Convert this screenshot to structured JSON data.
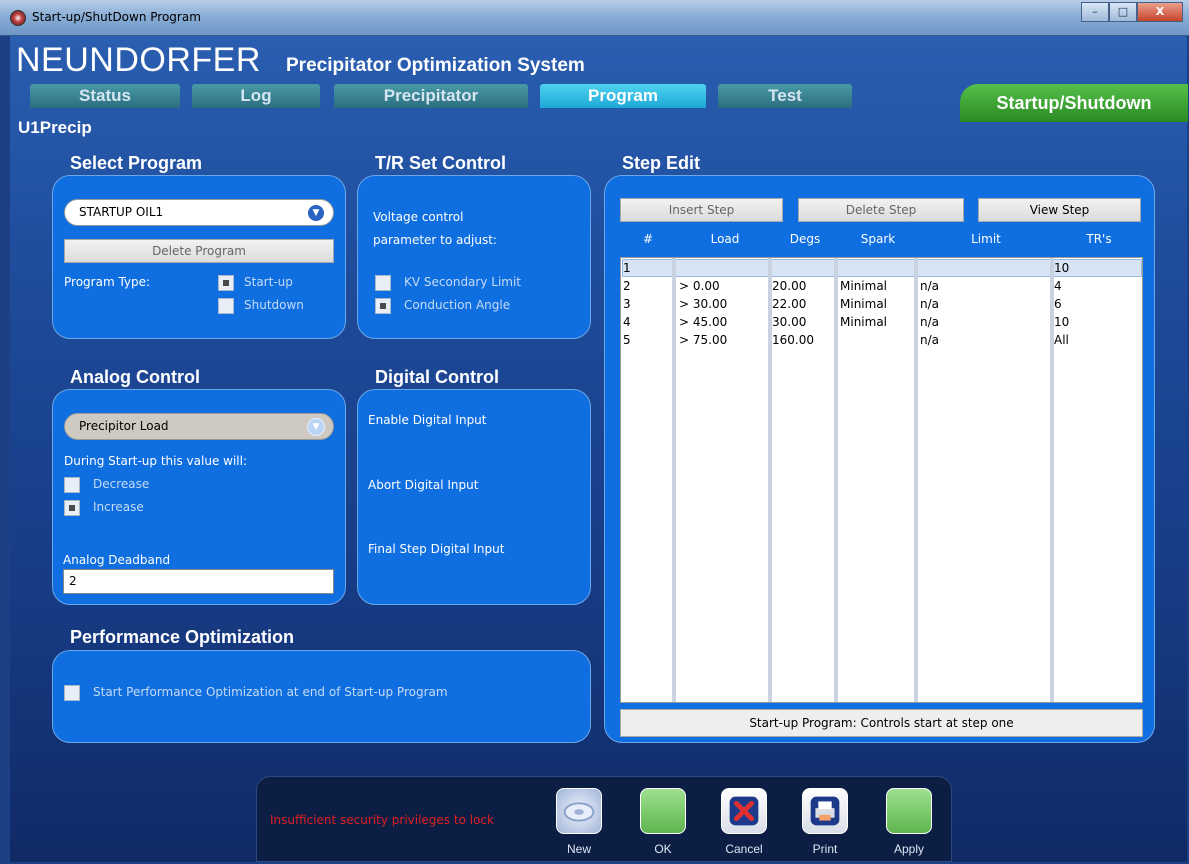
{
  "window": {
    "title": "Start-up/ShutDown Program",
    "controls": [
      "–",
      "□",
      "X"
    ]
  },
  "brand": {
    "name": "NEUNDORFER",
    "subtitle": "Precipitator Optimization System"
  },
  "tabs": [
    {
      "label": "Status"
    },
    {
      "label": "Log"
    },
    {
      "label": "Precipitator"
    },
    {
      "label": "Program",
      "active": true
    },
    {
      "label": "Test"
    }
  ],
  "section_tab": "Startup/Shutdown",
  "unit": "U1Precip",
  "select_program": {
    "title": "Select Program",
    "selected": "STARTUP OIL1",
    "delete_label": "Delete Program",
    "type_label": "Program Type:",
    "startup_label": "Start-up",
    "startup_checked": true,
    "shutdown_label": "Shutdown",
    "shutdown_checked": false
  },
  "tr_set": {
    "title": "T/R Set Control",
    "line1": "Voltage control",
    "line2": "parameter to adjust:",
    "kv_label": "KV Secondary Limit",
    "kv_checked": false,
    "cond_label": "Conduction Angle",
    "cond_checked": true
  },
  "analog": {
    "title": "Analog Control",
    "selected": "Precipitor Load",
    "during": "During Start-up this value will:",
    "decrease_label": "Decrease",
    "decrease_checked": false,
    "increase_label": "Increase",
    "increase_checked": true,
    "deadband_label": "Analog Deadband",
    "deadband_value": "2"
  },
  "digital": {
    "title": "Digital Control",
    "enable": "Enable Digital Input",
    "abort": "Abort Digital Input",
    "final": "Final Step Digital Input"
  },
  "performance": {
    "title": "Performance Optimization",
    "checkbox_label": "Start Performance Optimization at end of Start-up Program",
    "checked": false
  },
  "step_edit": {
    "title": "Step Edit",
    "insert_label": "Insert Step",
    "delete_label": "Delete Step",
    "view_label": "View Step",
    "columns": [
      "#",
      "Load",
      "Degs",
      "Spark",
      "Limit",
      "TR's"
    ],
    "rows": [
      {
        "num": "1",
        "load": "",
        "degs": "",
        "spark": "",
        "limit": "",
        "trs": "10"
      },
      {
        "num": "2",
        "load": "> 0.00",
        "degs": "20.00",
        "spark": "Minimal",
        "limit": "n/a",
        "trs": "4"
      },
      {
        "num": "3",
        "load": "> 30.00",
        "degs": "22.00",
        "spark": "Minimal",
        "limit": "n/a",
        "trs": "6"
      },
      {
        "num": "4",
        "load": "> 45.00",
        "degs": "30.00",
        "spark": "Minimal",
        "limit": "n/a",
        "trs": "10"
      },
      {
        "num": "5",
        "load": "> 75.00",
        "degs": "160.00",
        "spark": "",
        "limit": "n/a",
        "trs": "All"
      }
    ],
    "status": "Start-up Program: Controls start at step one"
  },
  "toolbar": {
    "warning": "Insufficient security privileges to lock",
    "new_label": "New",
    "ok_label": "OK",
    "cancel_label": "Cancel",
    "print_label": "Print",
    "apply_label": "Apply"
  },
  "colors": {
    "panel": "#0f6ee0",
    "background": "#1d3f86",
    "active_tab": "#1ea8d8",
    "section_tab": "#2a8a22",
    "warning": "#e02020"
  }
}
